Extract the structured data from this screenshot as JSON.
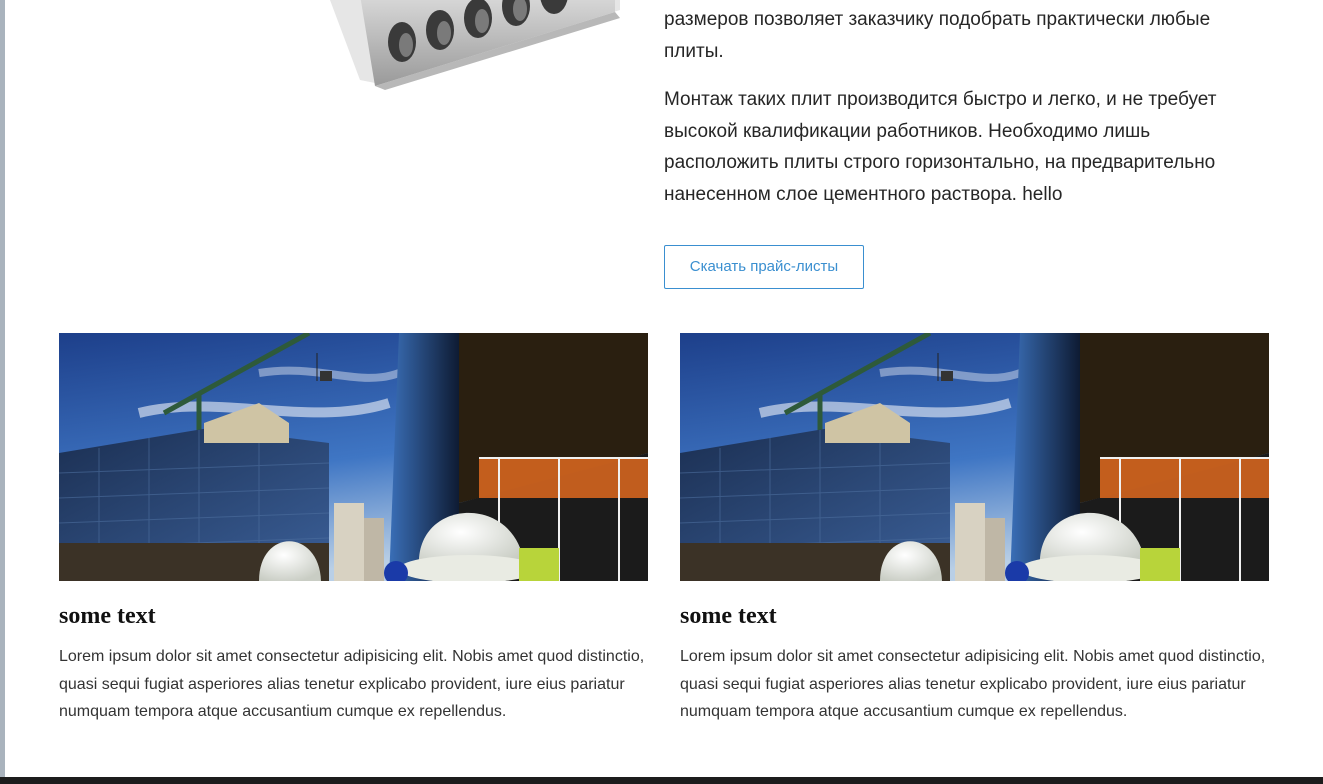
{
  "intro": {
    "paragraph_1": "размеров позволяет заказчику подобрать практически любые плиты.",
    "paragraph_2": "Монтаж таких плит производится быстро и легко, и не требует высокой квалификации работников. Необходимо лишь расположить плиты строго горизонтально, на предварительно нанесенном слое цементного раствора. hello",
    "download_button": "Скачать прайс-листы"
  },
  "cards": [
    {
      "title": "some text",
      "text": "Lorem ipsum dolor sit amet consectetur adipisicing elit. Nobis amet quod distinctio, quasi sequi fugiat asperiores alias tenetur explicabo provident, iure eius pariatur numquam tempora atque accusantium cumque ex repellendus."
    },
    {
      "title": "some text",
      "text": "Lorem ipsum dolor sit amet consectetur adipisicing elit. Nobis amet quod distinctio, quasi sequi fugiat asperiores alias tenetur explicabo provident, iure eius pariatur numquam tempora atque accusantium cumque ex repellendus."
    }
  ],
  "colors": {
    "accent": "#3a8fd0",
    "left_border": "#a9b3bd",
    "footer": "#1c1c1c"
  }
}
